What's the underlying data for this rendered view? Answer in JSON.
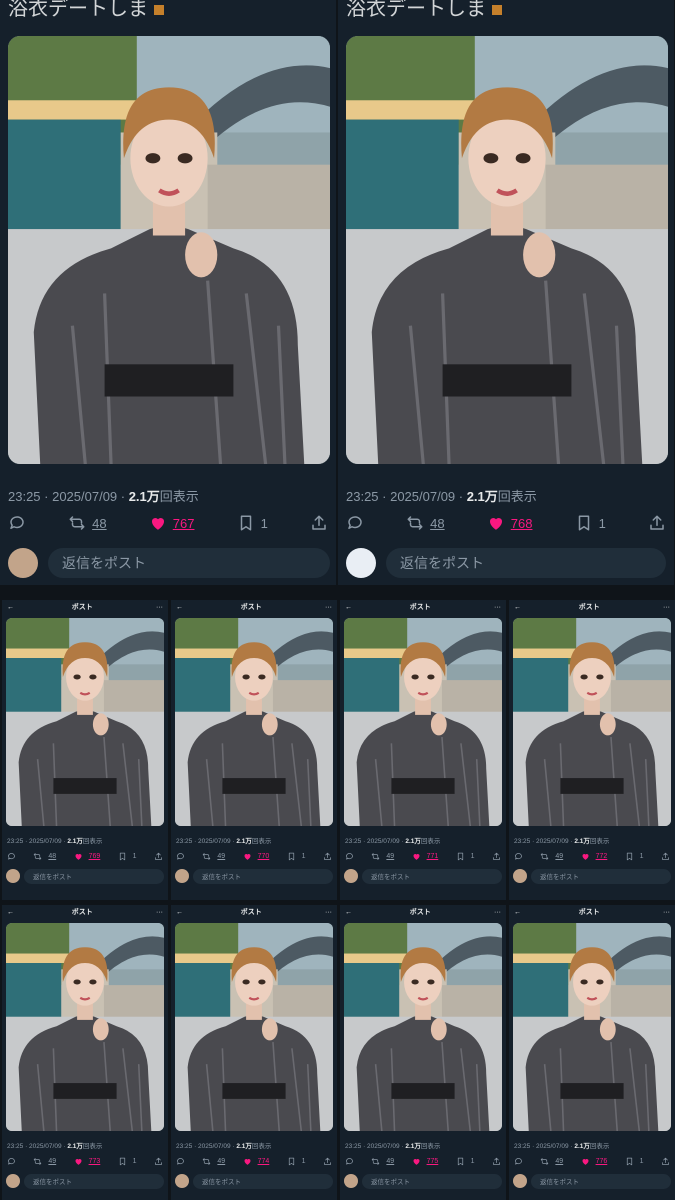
{
  "title_fragment": "浴衣デートしま",
  "header": {
    "back_label": "←",
    "title": "ポスト",
    "more_label": "···"
  },
  "reply_placeholder": "返信をポスト",
  "colors": {
    "background": "#0f1419",
    "panel": "#15202b",
    "like": "#f91880",
    "muted": "#8b98a5",
    "accent": "#1d9bf0"
  },
  "icons": [
    "reply-icon",
    "retweet-icon",
    "heart-icon",
    "bookmark-icon",
    "share-icon",
    "back-arrow-icon",
    "more-icon"
  ],
  "big_panels": [
    {
      "time": "23:25 · 2025/07/09 · ",
      "views": "2.1万",
      "views_label": "回表示",
      "retweets": "48",
      "likes": "767",
      "bookmarks": "1",
      "avatar": "user"
    },
    {
      "time": "23:25 · 2025/07/09 · ",
      "views": "2.1万",
      "views_label": "回表示",
      "retweets": "48",
      "likes": "768",
      "bookmarks": "1",
      "avatar": "alt"
    }
  ],
  "small_panels": [
    {
      "time": "23:25 · 2025/07/09 · ",
      "views": "2.1万",
      "views_label": "回表示",
      "retweets": "48",
      "likes": "769",
      "bookmarks": "1"
    },
    {
      "time": "23:25 · 2025/07/09 · ",
      "views": "2.1万",
      "views_label": "回表示",
      "retweets": "49",
      "likes": "770",
      "bookmarks": "1"
    },
    {
      "time": "23:25 · 2025/07/09 · ",
      "views": "2.1万",
      "views_label": "回表示",
      "retweets": "49",
      "likes": "771",
      "bookmarks": "1"
    },
    {
      "time": "23:25 · 2025/07/09 · ",
      "views": "2.1万",
      "views_label": "回表示",
      "retweets": "49",
      "likes": "772",
      "bookmarks": "1"
    },
    {
      "time": "23:25 · 2025/07/09 · ",
      "views": "2.1万",
      "views_label": "回表示",
      "retweets": "49",
      "likes": "773",
      "bookmarks": "1"
    },
    {
      "time": "23:25 · 2025/07/09 · ",
      "views": "2.1万",
      "views_label": "回表示",
      "retweets": "49",
      "likes": "774",
      "bookmarks": "1"
    },
    {
      "time": "23:25 · 2025/07/09 · ",
      "views": "2.1万",
      "views_label": "回表示",
      "retweets": "49",
      "likes": "775",
      "bookmarks": "1"
    },
    {
      "time": "23:25 · 2025/07/09 · ",
      "views": "2.1万",
      "views_label": "回表示",
      "retweets": "49",
      "likes": "776",
      "bookmarks": "1"
    }
  ]
}
